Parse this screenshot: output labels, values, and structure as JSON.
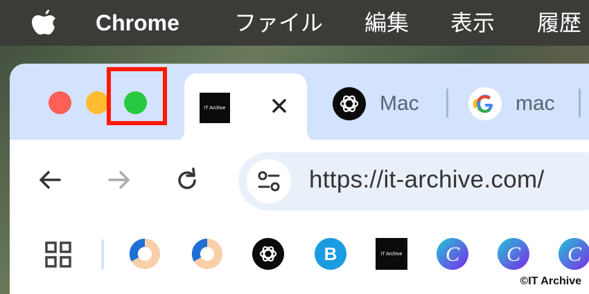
{
  "menubar": {
    "apple": "apple-logo",
    "app_name": "Chrome",
    "items": [
      "ファイル",
      "編集",
      "表示",
      "履歴"
    ]
  },
  "window": {
    "traffic_lights": [
      "close",
      "minimize",
      "zoom"
    ],
    "highlight_color": "#ff1a00"
  },
  "tabs": [
    {
      "favicon": "IT Archive",
      "label": "",
      "active": true,
      "close": "×"
    },
    {
      "favicon": "openai-icon",
      "label": "Mac",
      "active": false
    },
    {
      "favicon": "google-icon",
      "label": "mac",
      "active": false
    }
  ],
  "toolbar": {
    "back": "back-arrow-icon",
    "forward": "forward-arrow-icon",
    "reload": "reload-icon",
    "url": "https://it-archive.com/"
  },
  "bookmarks": {
    "apps": "apps-grid-icon",
    "items": [
      "ring-icon",
      "ring-icon",
      "openai-icon",
      "b-icon",
      "IT Archive",
      "canva-icon",
      "canva-icon",
      "canva-icon"
    ]
  },
  "watermark": "©IT Archive",
  "colors": {
    "tab_strip": "#d3e3fd",
    "close": "#ff5f57",
    "minimize": "#febc2e",
    "zoom": "#28c840"
  }
}
